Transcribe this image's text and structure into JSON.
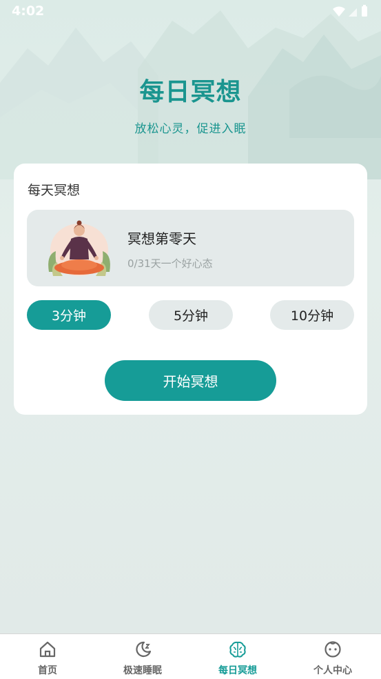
{
  "status_bar": {
    "time": "4:02"
  },
  "hero": {
    "title": "每日冥想",
    "subtitle": "放松心灵，促进入眠"
  },
  "card": {
    "title": "每天冥想",
    "session": {
      "name": "冥想第零天",
      "progress_text": "0/31天一个好心态"
    },
    "durations": [
      {
        "label": "3分钟",
        "selected": true
      },
      {
        "label": "5分钟",
        "selected": false
      },
      {
        "label": "10分钟",
        "selected": false
      }
    ],
    "start_label": "开始冥想"
  },
  "tabbar": {
    "items": [
      {
        "label": "首页",
        "icon": "home-icon",
        "active": false
      },
      {
        "label": "极速睡眠",
        "icon": "moon-icon",
        "active": false
      },
      {
        "label": "每日冥想",
        "icon": "brain-icon",
        "active": true
      },
      {
        "label": "个人中心",
        "icon": "face-icon",
        "active": false
      }
    ]
  },
  "colors": {
    "accent": "#169c97",
    "title": "#1a958f",
    "card_bg": "#ffffff",
    "pill_bg": "#e4eaea"
  }
}
